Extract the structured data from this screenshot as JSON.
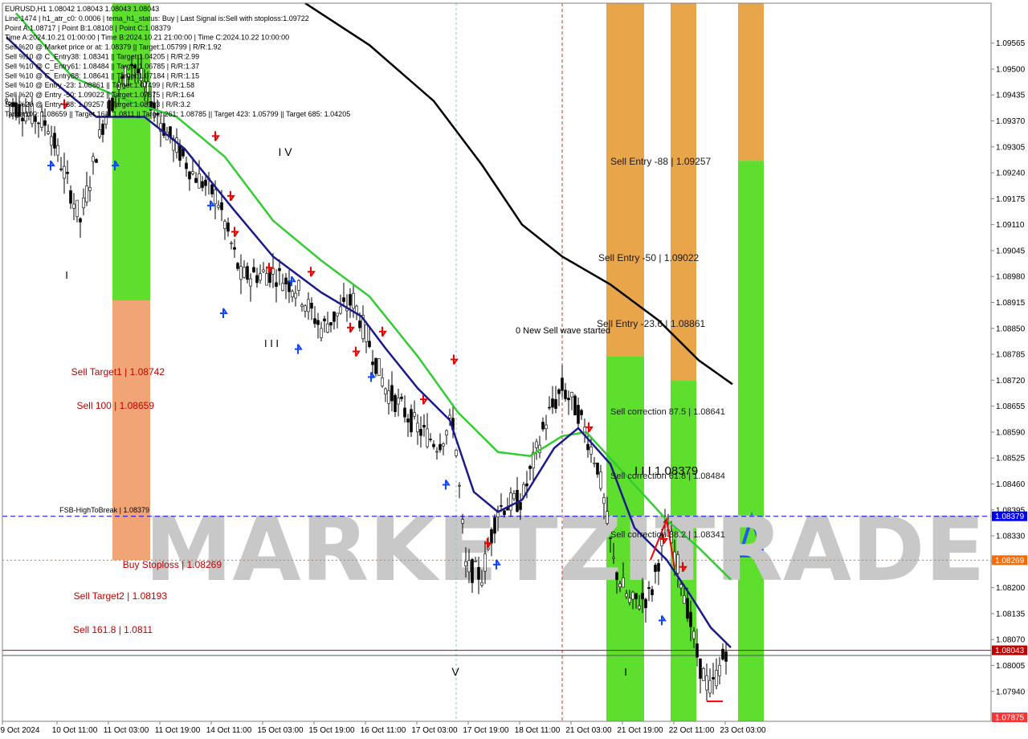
{
  "chart_data": {
    "type": "candlestick",
    "symbol": "EURUSD,H1",
    "ylim": [
      1.07865,
      1.09665
    ],
    "price_ticks": [
      "1.09565",
      "1.09500",
      "1.09435",
      "1.09370",
      "1.09305",
      "1.09240",
      "1.09175",
      "1.09110",
      "1.09045",
      "1.08980",
      "1.08915",
      "1.08850",
      "1.08785",
      "1.08720",
      "1.08655",
      "1.08590",
      "1.08525",
      "1.08460",
      "1.08395",
      "1.08330",
      "1.08265",
      "1.08200",
      "1.08135",
      "1.08070",
      "1.08005",
      "1.07940"
    ],
    "time_ticks": [
      "9 Oct 2024",
      "10 Oct 11:00",
      "11 Oct 03:00",
      "11 Oct 19:00",
      "14 Oct 11:00",
      "15 Oct 03:00",
      "15 Oct 19:00",
      "16 Oct 11:00",
      "17 Oct 03:00",
      "17 Oct 19:00",
      "18 Oct 11:00",
      "21 Oct 03:00",
      "21 Oct 19:00",
      "22 Oct 11:00",
      "23 Oct 03:00"
    ],
    "price_tags": [
      {
        "text": "1.08379",
        "color": "#0000ff"
      },
      {
        "text": "1.08269",
        "color": "#ff6a00"
      },
      {
        "text": "1.08043",
        "color": "#c00000"
      },
      {
        "text": "1.07875",
        "color": "#ff3333"
      }
    ],
    "info_lines": [
      "EURUSD,H1  1.08042 1.08043 1.08043 1.08043",
      "Line:1474  | h1_atr_c0: 0.0006 | tema_h1_status: Buy | Last Signal is:Sell with stoploss:1.09722",
      "Point A:1.08717 | Point B:1.08108 | Point C:1.08379",
      "Time A:2024.10.21 01:00:00 | Time B:2024.10.21 21:00:00 | Time C:2024.10.22 10:00:00",
      "Sell %20 @ Market price or at: 1.08379 || Target:1.05799 | R/R:1.92",
      "Sell %10 @ C_Entry38: 1.08341 || Target:1.04205 | R/R:2.99",
      "Sell %10 @ C_Entry61: 1.08484 || Target:1.06785 | R/R:1.37",
      "Sell %10 @ C_Entry88: 1.08641 || Target:1.07184 | R/R:1.15",
      "Sell %10 @ Entry -23: 1.08861 || Target:1.07499 | R/R:1.58",
      "Sell %20 @ Entry -50: 1.09022 || Target:1.07875 | R/R:1.64",
      "Sell %20 @ Entry -88: 1.09257 || Target:1.08193 | R/R:3.2",
      "Target100: 1.08659 || Target 161: 1.0811 || Target 261: 1.08785 || Target 423: 1.05799 || Target 685: 1.04205"
    ],
    "annotations": [
      {
        "text": "Sell Entry -88 | 1.09257",
        "color": "#1a1a1a"
      },
      {
        "text": "Sell Entry -50 | 1.09022",
        "color": "#1a1a1a"
      },
      {
        "text": "Sell Entry -23.6 | 1.08861",
        "color": "#1a1a1a"
      },
      {
        "text": "0 New Sell wave started",
        "color": "#000000"
      },
      {
        "text": "Sell correction 87.5 | 1.08641",
        "color": "#1a1a1a"
      },
      {
        "text": "Sell correction 61.8 | 1.08484",
        "color": "#1a1a1a"
      },
      {
        "text": "Sell correction 38.2 | 1.08341",
        "color": "#1a1a1a"
      },
      {
        "text": "I I I 1.08379",
        "color": "#000000"
      },
      {
        "text": "Sell Target1 | 1.08742",
        "color": "#c00000"
      },
      {
        "text": "Sell 100 | 1.08659",
        "color": "#c00000"
      },
      {
        "text": "FSB-HighToBreak | 1.08379",
        "color": "#000000"
      },
      {
        "text": "Buy Stoploss | 1.08269",
        "color": "#c00000"
      },
      {
        "text": "Sell Target2 | 1.08193",
        "color": "#c00000"
      },
      {
        "text": "Sell 161.8 | 1.0811",
        "color": "#c00000"
      }
    ],
    "wave_labels": [
      "I V",
      "I",
      "I I I",
      "V",
      "I"
    ],
    "watermark": "MARKETZITRADE",
    "key_levels": [
      {
        "name": "FSB-HighToBreak",
        "price": 1.08379,
        "color": "#0000ff",
        "style": "dashed"
      },
      {
        "name": "Buy Stoploss",
        "price": 1.08269,
        "color": "#ff6a00",
        "style": "dotted"
      },
      {
        "name": "Current",
        "price": 1.08043,
        "color": "#c00000",
        "style": "solid"
      }
    ],
    "zones": [
      {
        "name": "zone-left-green",
        "color": "#55dd22",
        "from": 1.09665,
        "to": 1.0892
      },
      {
        "name": "zone-left-orange",
        "color": "#f0a070",
        "from": 1.0892,
        "to": 1.08269
      },
      {
        "name": "zone-mid-orange",
        "color": "#e8a040",
        "from": 1.09665,
        "to": 1.0878
      },
      {
        "name": "zone-mid-green",
        "color": "#55dd22",
        "from": 1.0878,
        "to": 1.07865
      },
      {
        "name": "zone-right-orange",
        "color": "#e8a040",
        "from": 1.09665,
        "to": 1.0872
      },
      {
        "name": "zone-right-green",
        "color": "#55dd22",
        "from": 1.0872,
        "to": 1.07865
      },
      {
        "name": "zone-far-orange",
        "color": "#e8a040",
        "from": 1.09665,
        "to": 1.0927
      },
      {
        "name": "zone-far-green",
        "color": "#55dd22",
        "from": 1.0927,
        "to": 1.07865
      }
    ],
    "colors": {
      "up": "#000000",
      "down": "#000000",
      "ema_fast": "#1a1a8c",
      "ema_slow": "#33cc33",
      "ma_long": "#000000",
      "grid": "#c0c0c0"
    }
  }
}
